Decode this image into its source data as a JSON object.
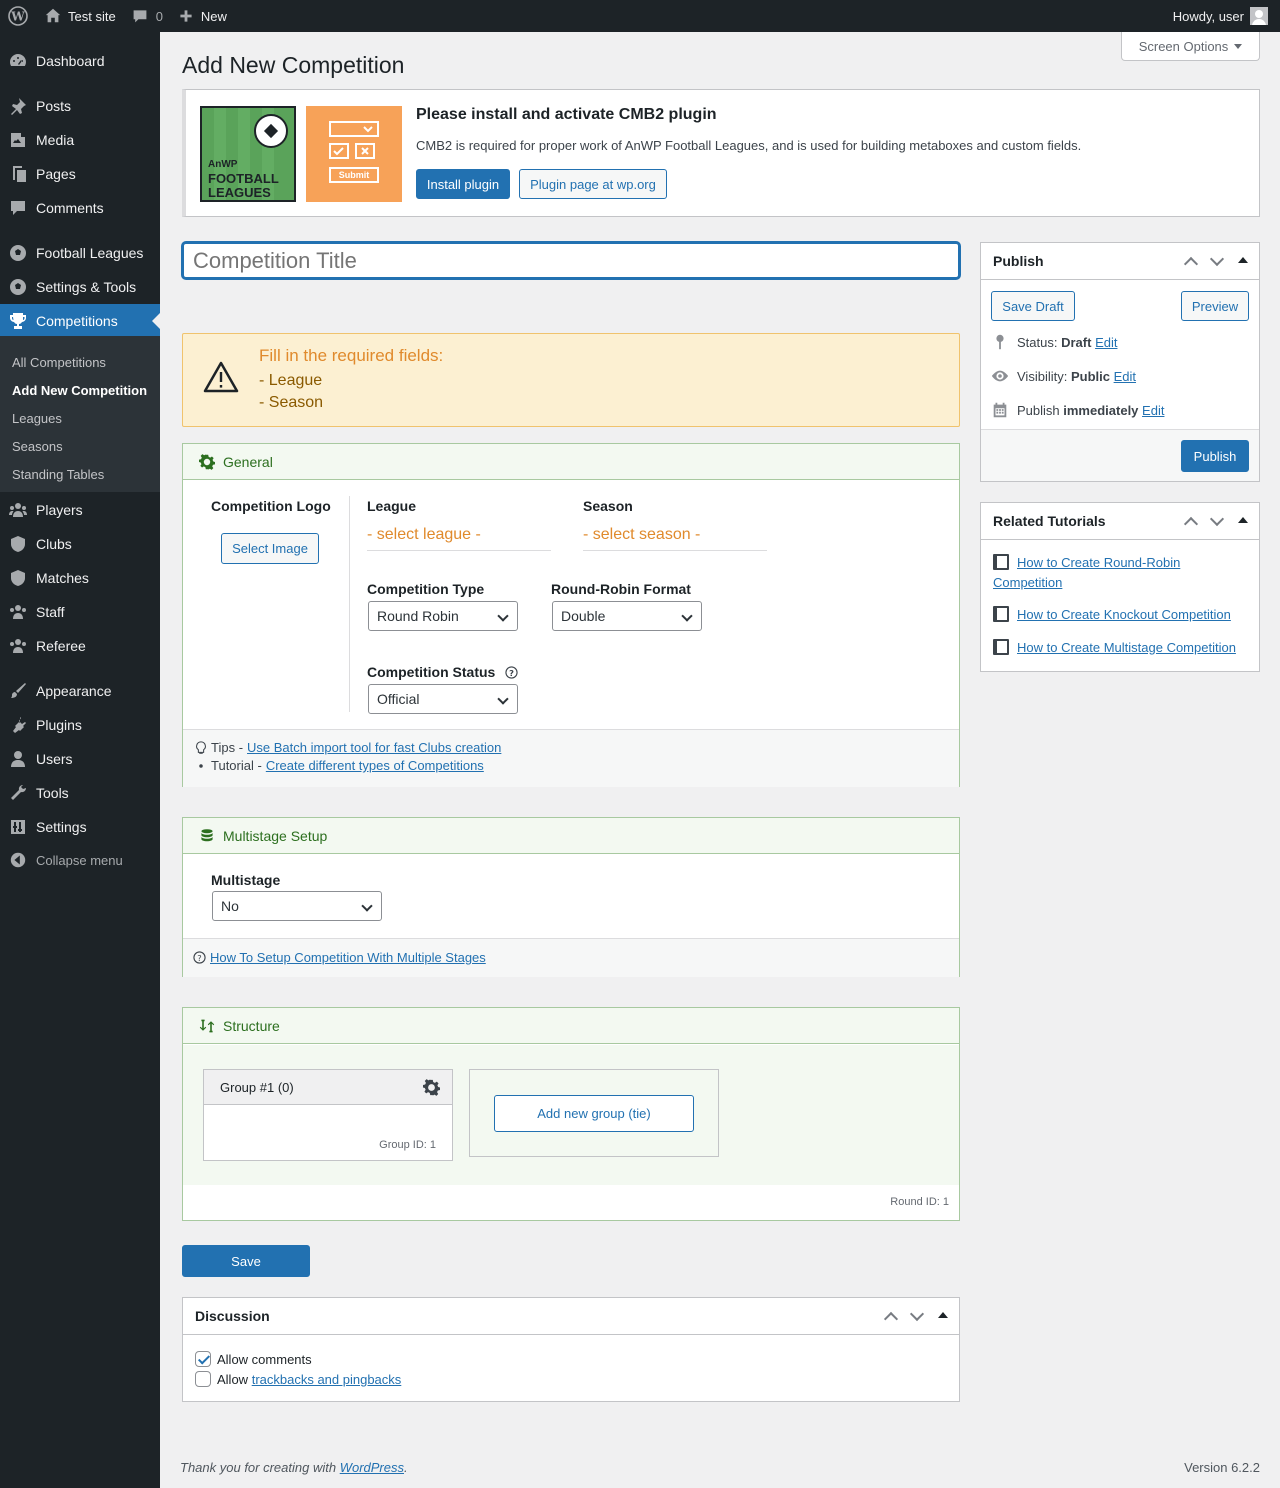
{
  "adminbar": {
    "site_name": "Test site",
    "comments_count": "0",
    "new_label": "New",
    "howdy": "Howdy, user"
  },
  "sidebar": {
    "items": [
      {
        "label": "Dashboard",
        "icon": "dashboard-icon"
      },
      {
        "label": "Posts",
        "icon": "pin-icon"
      },
      {
        "label": "Media",
        "icon": "media-icon"
      },
      {
        "label": "Pages",
        "icon": "pages-icon"
      },
      {
        "label": "Comments",
        "icon": "comments-icon"
      },
      {
        "label": "Football Leagues",
        "icon": "football-icon"
      },
      {
        "label": "Settings & Tools",
        "icon": "football-icon"
      },
      {
        "label": "Competitions",
        "icon": "trophy-icon"
      },
      {
        "label": "Players",
        "icon": "group-icon"
      },
      {
        "label": "Clubs",
        "icon": "shield-icon"
      },
      {
        "label": "Matches",
        "icon": "shield-icon"
      },
      {
        "label": "Staff",
        "icon": "group-icon"
      },
      {
        "label": "Referee",
        "icon": "group-icon"
      },
      {
        "label": "Appearance",
        "icon": "brush-icon"
      },
      {
        "label": "Plugins",
        "icon": "plug-icon"
      },
      {
        "label": "Users",
        "icon": "user-icon"
      },
      {
        "label": "Tools",
        "icon": "wrench-icon"
      },
      {
        "label": "Settings",
        "icon": "sliders-icon"
      }
    ],
    "submenu": [
      "All Competitions",
      "Add New Competition",
      "Leagues",
      "Seasons",
      "Standing Tables"
    ],
    "collapse": "Collapse menu"
  },
  "header": {
    "title": "Add New Competition",
    "screen_options": "Screen Options"
  },
  "notice": {
    "logo_line1": "AnWP",
    "logo_line2": "FOOTBALL",
    "logo_line3": "LEAGUES",
    "submit_label": "Submit",
    "title": "Please install and activate CMB2 plugin",
    "desc": "CMB2 is required for proper work of AnWP Football Leagues, and is used for building metaboxes and custom fields.",
    "install_btn": "Install plugin",
    "plugin_page_btn": "Plugin page at wp.org"
  },
  "title_input": {
    "placeholder": "Competition Title"
  },
  "warning": {
    "title": "Fill in the required fields:",
    "fields": [
      "- League",
      "- Season"
    ]
  },
  "general": {
    "heading": "General",
    "logo_label": "Competition Logo",
    "select_image": "Select Image",
    "league_label": "League",
    "league_value": "- select league -",
    "season_label": "Season",
    "season_value": "- select season -",
    "type_label": "Competition Type",
    "type_value": "Round Robin",
    "format_label": "Round-Robin Format",
    "format_value": "Double",
    "status_label": "Competition Status",
    "status_value": "Official",
    "tips_prefix": "Tips -",
    "tips_link": "Use Batch import tool for fast Clubs creation",
    "tutorial_prefix": "Tutorial -",
    "tutorial_link": "Create different types of Competitions"
  },
  "multistage": {
    "heading": "Multistage Setup",
    "label": "Multistage",
    "value": "No",
    "help_link": "How To Setup Competition With Multiple Stages"
  },
  "structure": {
    "heading": "Structure",
    "group_title": "Group #1 (0)",
    "group_id": "Group ID: 1",
    "add_group": "Add new group (tie)",
    "round_id": "Round ID: 1"
  },
  "save_btn": "Save",
  "discussion": {
    "heading": "Discussion",
    "allow_comments": "Allow comments",
    "allow_prefix": "Allow",
    "trackbacks_link": "trackbacks and pingbacks"
  },
  "publish": {
    "heading": "Publish",
    "save_draft": "Save Draft",
    "preview": "Preview",
    "status_label": "Status:",
    "status_value": "Draft",
    "visibility_label": "Visibility:",
    "visibility_value": "Public",
    "publish_label": "Publish",
    "publish_value": "immediately",
    "edit": "Edit",
    "publish_btn": "Publish"
  },
  "tutorials": {
    "heading": "Related Tutorials",
    "items": [
      "How to Create Round-Robin Competition",
      "How to Create Knockout Competition",
      "How to Create Multistage Competition"
    ]
  },
  "footer": {
    "thanks_prefix": "Thank you for creating with",
    "wp_link": "WordPress",
    "thanks_suffix": ".",
    "version": "Version 6.2.2"
  },
  "colors": {
    "accent": "#2271b1",
    "sidebar_bg": "#1d2327",
    "warning_text": "#e08a2c",
    "box_header_green": "#2c6f1f"
  }
}
